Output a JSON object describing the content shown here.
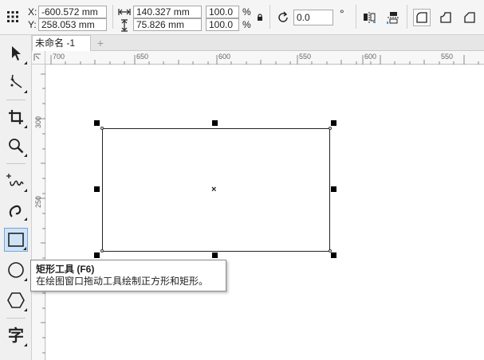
{
  "property_bar": {
    "x_label": "X:",
    "y_label": "Y:",
    "x_value": "-600.572 mm",
    "y_value": "258.053 mm",
    "width_value": "140.327 mm",
    "height_value": "75.826 mm",
    "scale_w_value": "100.0",
    "scale_h_value": "100.0",
    "percent_symbol": "%",
    "rotation_value": "0.0",
    "degree_symbol": "°"
  },
  "document": {
    "tab_label": "未命名 -1",
    "add_tab_symbol": "+"
  },
  "ruler": {
    "top_ticks": [
      "700",
      "650",
      "600",
      "550",
      "600",
      "550"
    ],
    "left_ticks": [
      "300",
      "250"
    ]
  },
  "toolbox": {
    "text_tool_glyph": "字"
  },
  "tooltip": {
    "title": "矩形工具 (F6)",
    "description": "在绘图窗口拖动工具绘制正方形和矩形。"
  },
  "colors": {
    "active_tool_bg": "#cfe3f7",
    "active_tool_border": "#6fa8dc",
    "canvas": "#ffffff"
  }
}
